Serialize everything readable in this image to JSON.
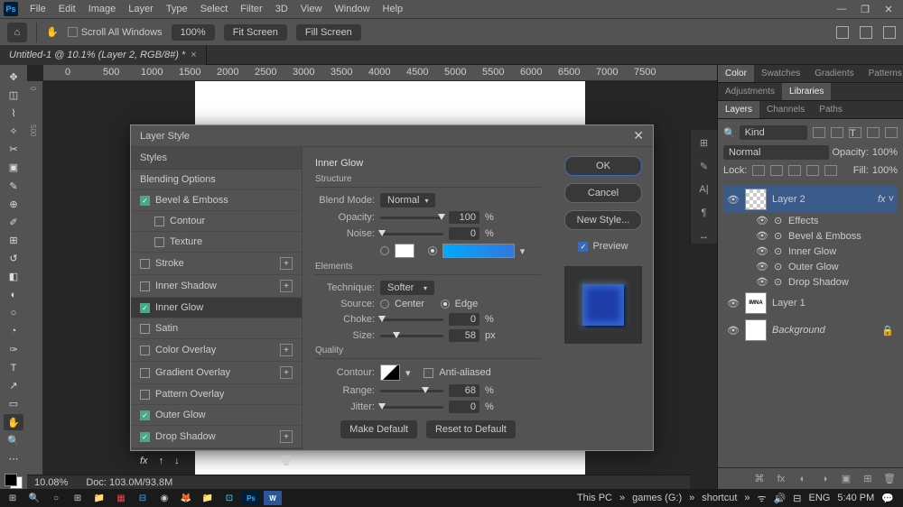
{
  "menu": [
    "File",
    "Edit",
    "Image",
    "Layer",
    "Type",
    "Select",
    "Filter",
    "3D",
    "View",
    "Window",
    "Help"
  ],
  "optbar": {
    "scroll_all": "Scroll All Windows",
    "zoom": "100%",
    "fit": "Fit Screen",
    "fill": "Fill Screen"
  },
  "doc_tab": "Untitled-1 @ 10.1% (Layer 2, RGB/8#) *",
  "ruler_h": [
    "0",
    "500",
    "1000",
    "1500",
    "2000",
    "2500",
    "3000",
    "3500",
    "4000",
    "4500",
    "5000",
    "5500",
    "6000",
    "6500",
    "7000",
    "7500"
  ],
  "ruler_v": [
    "0",
    "500"
  ],
  "status": {
    "zoom": "10.08%",
    "doc": "Doc: 103.0M/93.8M"
  },
  "right_panels": {
    "tabs1": [
      "Color",
      "Swatches",
      "Gradients",
      "Patterns"
    ],
    "tabs2": [
      "Adjustments",
      "Libraries"
    ],
    "tabs3": [
      "Layers",
      "Channels",
      "Paths"
    ],
    "kind": "Kind",
    "blend": "Normal",
    "opacity_lbl": "Opacity:",
    "opacity": "100%",
    "fill_lbl": "Fill:",
    "fill": "100%",
    "lock": "Lock:"
  },
  "layers": [
    {
      "name": "Layer 2",
      "selected": true,
      "thumb": "checker",
      "fx": true
    },
    {
      "name": "Layer 1",
      "thumb": "logo"
    },
    {
      "name": "Background",
      "thumb": "white",
      "locked": true,
      "italic": true
    }
  ],
  "effects_label": "Effects",
  "effects": [
    "Bevel & Emboss",
    "Inner Glow",
    "Outer Glow",
    "Drop Shadow"
  ],
  "dialog": {
    "title": "Layer Style",
    "left_header": "Styles",
    "blending": "Blending Options",
    "items": [
      {
        "label": "Bevel & Emboss",
        "checked": true
      },
      {
        "label": "Contour",
        "indent": true
      },
      {
        "label": "Texture",
        "indent": true
      },
      {
        "label": "Stroke",
        "plus": true
      },
      {
        "label": "Inner Shadow",
        "plus": true
      },
      {
        "label": "Inner Glow",
        "checked": true,
        "selected": true
      },
      {
        "label": "Satin"
      },
      {
        "label": "Color Overlay",
        "plus": true
      },
      {
        "label": "Gradient Overlay",
        "plus": true
      },
      {
        "label": "Pattern Overlay"
      },
      {
        "label": "Outer Glow",
        "checked": true
      },
      {
        "label": "Drop Shadow",
        "checked": true,
        "plus": true
      }
    ],
    "footer_fx": "fx",
    "mid": {
      "title": "Inner Glow",
      "structure": "Structure",
      "blend_mode_lbl": "Blend Mode:",
      "blend_mode": "Normal",
      "opacity_lbl": "Opacity:",
      "opacity": "100",
      "pct": "%",
      "noise_lbl": "Noise:",
      "noise": "0",
      "elements": "Elements",
      "technique_lbl": "Technique:",
      "technique": "Softer",
      "source_lbl": "Source:",
      "center": "Center",
      "edge": "Edge",
      "choke_lbl": "Choke:",
      "choke": "0",
      "size_lbl": "Size:",
      "size": "58",
      "px": "px",
      "quality": "Quality",
      "contour_lbl": "Contour:",
      "anti": "Anti-aliased",
      "range_lbl": "Range:",
      "range": "68",
      "jitter_lbl": "Jitter:",
      "jitter": "0",
      "make_default": "Make Default",
      "reset": "Reset to Default"
    },
    "right": {
      "ok": "OK",
      "cancel": "Cancel",
      "new_style": "New Style...",
      "preview": "Preview"
    }
  },
  "taskbar": {
    "tray": [
      "This PC",
      "games (G:)",
      "shortcut"
    ],
    "lang": "ENG",
    "time": "5:40 PM"
  }
}
